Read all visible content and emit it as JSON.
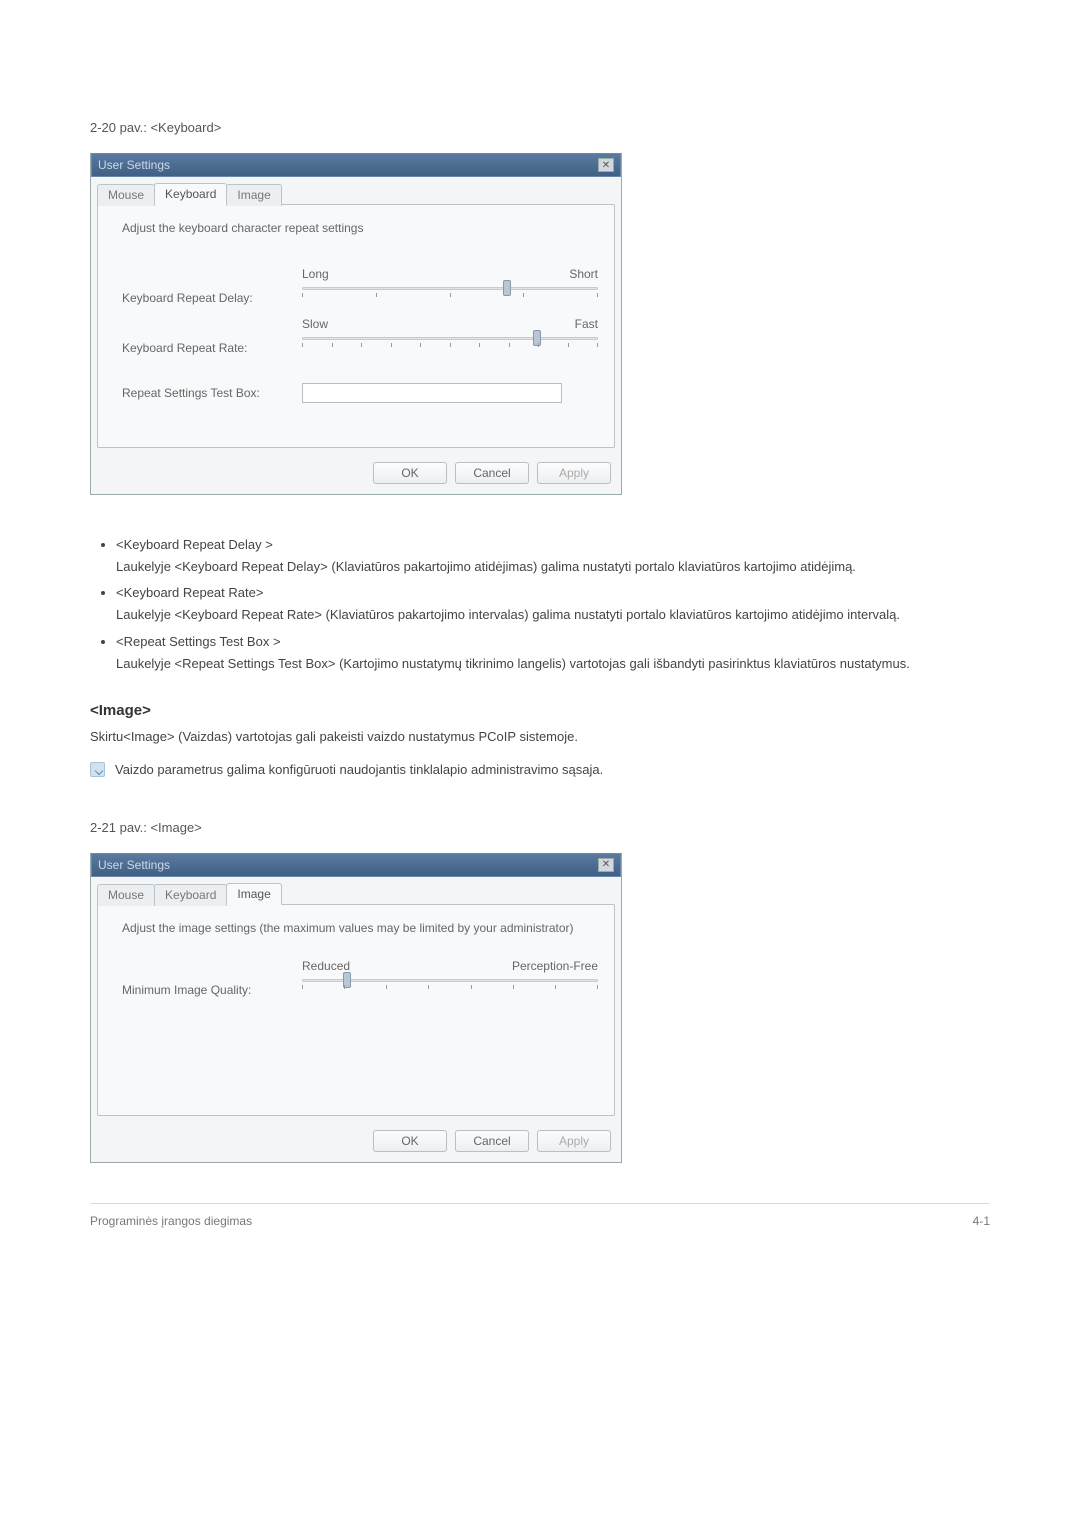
{
  "fig1_caption": "2-20 pav.: <Keyboard>",
  "dialog1": {
    "title": "User Settings",
    "tabs": {
      "mouse": "Mouse",
      "keyboard": "Keyboard",
      "image": "Image"
    },
    "desc": "Adjust the keyboard character repeat settings",
    "delay_label": "Keyboard Repeat Delay:",
    "delay_left": "Long",
    "delay_right": "Short",
    "rate_label": "Keyboard Repeat Rate:",
    "rate_left": "Slow",
    "rate_right": "Fast",
    "testbox_label": "Repeat Settings Test Box:",
    "ok": "OK",
    "cancel": "Cancel",
    "apply": "Apply"
  },
  "bullets": {
    "b1_term": "<Keyboard Repeat Delay >",
    "b1_text": "Laukelyje <Keyboard Repeat Delay> (Klaviatūros pakartojimo atidėjimas) galima nustatyti portalo klaviatūros kartojimo atidėjimą.",
    "b2_term": "<Keyboard Repeat Rate>",
    "b2_text": "Laukelyje <Keyboard Repeat Rate> (Klaviatūros pakartojimo intervalas) galima nustatyti portalo klaviatūros kartojimo atidėjimo intervalą.",
    "b3_term": "<Repeat Settings Test Box >",
    "b3_text": "Laukelyje <Repeat Settings Test Box> (Kartojimo nustatymų tikrinimo langelis) vartotojas gali išbandyti pasirinktus klaviatūros nustatymus."
  },
  "section_heading": "<Image>",
  "section_para": "Skirtu<Image> (Vaizdas) vartotojas gali pakeisti vaizdo nustatymus PCoIP sistemoje.",
  "note_text": "Vaizdo parametrus galima konfigūruoti naudojantis tinklalapio administravimo sąsaja.",
  "fig2_caption": "2-21 pav.: <Image>",
  "dialog2": {
    "title": "User Settings",
    "tabs": {
      "mouse": "Mouse",
      "keyboard": "Keyboard",
      "image": "Image"
    },
    "desc": "Adjust the image settings (the maximum values may be limited by your administrator)",
    "quality_label": "Minimum Image Quality:",
    "quality_left": "Reduced",
    "quality_right": "Perception-Free",
    "ok": "OK",
    "cancel": "Cancel",
    "apply": "Apply"
  },
  "footer_left": "Programinės įrangos diegimas",
  "footer_right": "4-1"
}
